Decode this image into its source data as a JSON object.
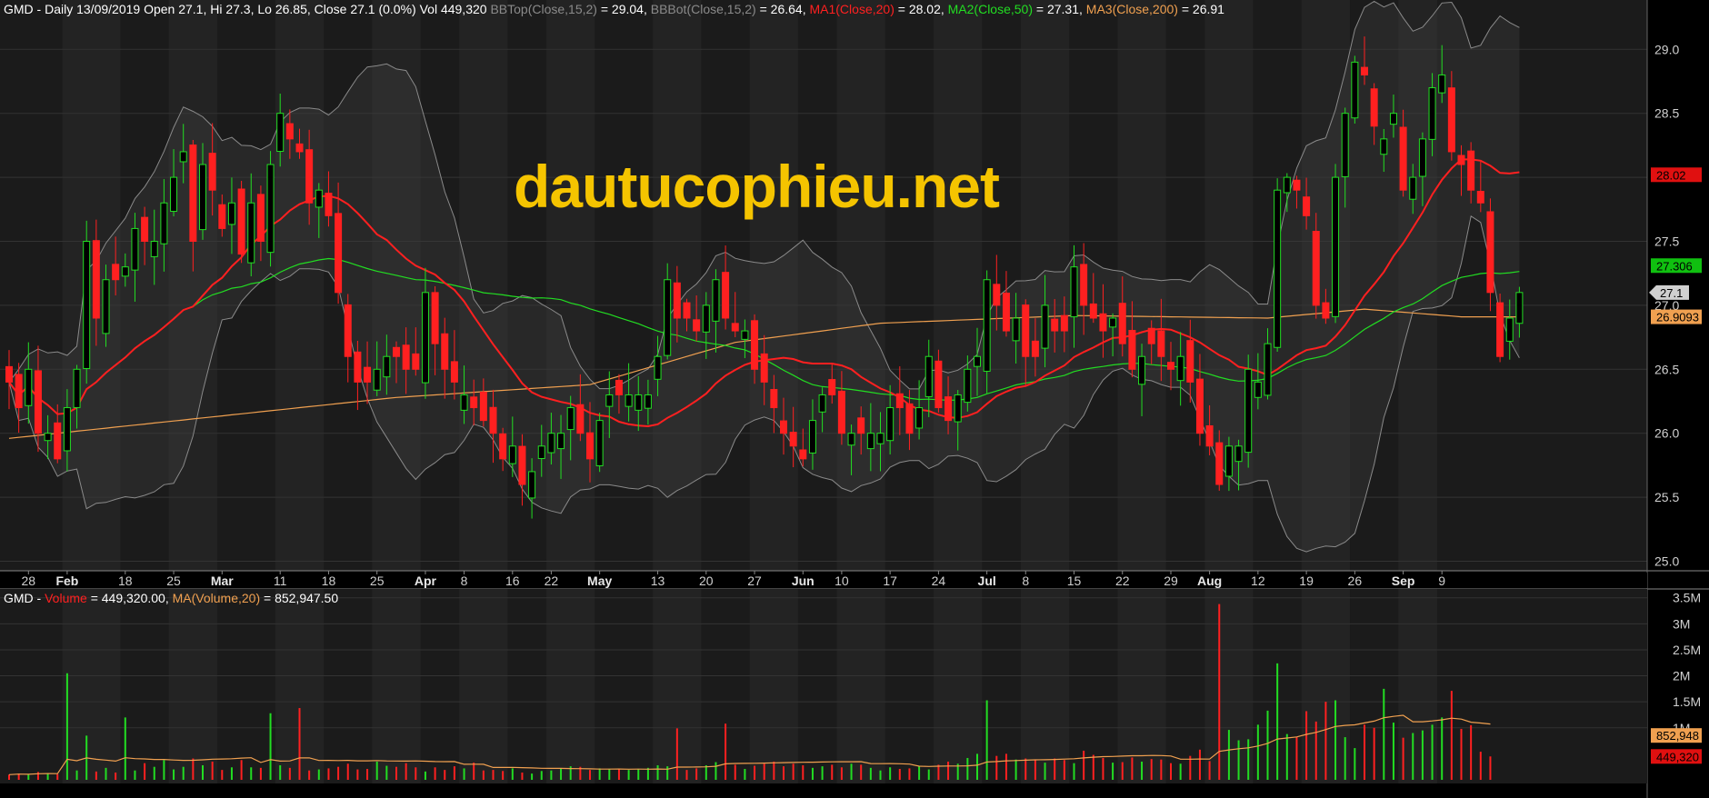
{
  "header": {
    "price_parts": [
      {
        "text": "GMD - Daily 13/09/2019 Open 27.1, Hi 27.3, Lo 26.85, Close 27.1 (0.0%) Vol 449,320 ",
        "color": "#ffffff"
      },
      {
        "text": "BBTop(Close,15,2)",
        "color": "#8a8a8a"
      },
      {
        "text": " = 29.04, ",
        "color": "#ffffff"
      },
      {
        "text": "BBBot(Close,15,2)",
        "color": "#8a8a8a"
      },
      {
        "text": " = 26.64, ",
        "color": "#ffffff"
      },
      {
        "text": "MA1(Close,20)",
        "color": "#ff2020"
      },
      {
        "text": " = 28.02, ",
        "color": "#ffffff"
      },
      {
        "text": "MA2(Close,50)",
        "color": "#22dd22"
      },
      {
        "text": " = 27.31, ",
        "color": "#ffffff"
      },
      {
        "text": "MA3(Close,200)",
        "color": "#f0a050"
      },
      {
        "text": " = 26.91",
        "color": "#ffffff"
      }
    ],
    "volume_parts": [
      {
        "text": "GMD - ",
        "color": "#ffffff"
      },
      {
        "text": "Volume",
        "color": "#ff2020"
      },
      {
        "text": " = 449,320.00, ",
        "color": "#ffffff"
      },
      {
        "text": "MA(Volume,20)",
        "color": "#f0a050"
      },
      {
        "text": " = 852,947.50",
        "color": "#ffffff"
      }
    ]
  },
  "watermark": "dautucophieu.net",
  "chart_data": [
    {
      "type": "candlestick",
      "name": "price",
      "ylim": [
        24.9,
        29.3
      ],
      "y_ticks": [
        {
          "value": 25.0,
          "label": "25.0"
        },
        {
          "value": 25.5,
          "label": "25.5"
        },
        {
          "value": 26.0,
          "label": "26.0"
        },
        {
          "value": 26.5,
          "label": "26.5"
        },
        {
          "value": 27.0,
          "label": "27.0"
        },
        {
          "value": 27.5,
          "label": "27.5"
        },
        {
          "value": 28.0,
          "label": "28.0"
        },
        {
          "value": 28.5,
          "label": "28.5"
        },
        {
          "value": 29.0,
          "label": "29.0"
        }
      ],
      "x_ticks": [
        {
          "index": 2,
          "label": "28",
          "month": false
        },
        {
          "index": 6,
          "label": "Feb",
          "month": true
        },
        {
          "index": 12,
          "label": "18",
          "month": false
        },
        {
          "index": 17,
          "label": "25",
          "month": false
        },
        {
          "index": 22,
          "label": "Mar",
          "month": true
        },
        {
          "index": 28,
          "label": "11",
          "month": false
        },
        {
          "index": 33,
          "label": "18",
          "month": false
        },
        {
          "index": 38,
          "label": "25",
          "month": false
        },
        {
          "index": 43,
          "label": "Apr",
          "month": true
        },
        {
          "index": 47,
          "label": "8",
          "month": false
        },
        {
          "index": 52,
          "label": "16",
          "month": false
        },
        {
          "index": 56,
          "label": "22",
          "month": false
        },
        {
          "index": 61,
          "label": "May",
          "month": true
        },
        {
          "index": 67,
          "label": "13",
          "month": false
        },
        {
          "index": 72,
          "label": "20",
          "month": false
        },
        {
          "index": 77,
          "label": "27",
          "month": false
        },
        {
          "index": 82,
          "label": "Jun",
          "month": true
        },
        {
          "index": 86,
          "label": "10",
          "month": false
        },
        {
          "index": 91,
          "label": "17",
          "month": false
        },
        {
          "index": 96,
          "label": "24",
          "month": false
        },
        {
          "index": 101,
          "label": "Jul",
          "month": true
        },
        {
          "index": 105,
          "label": "8",
          "month": false
        },
        {
          "index": 110,
          "label": "15",
          "month": false
        },
        {
          "index": 115,
          "label": "22",
          "month": false
        },
        {
          "index": 120,
          "label": "29",
          "month": false
        },
        {
          "index": 124,
          "label": "Aug",
          "month": true
        },
        {
          "index": 129,
          "label": "12",
          "month": false
        },
        {
          "index": 134,
          "label": "19",
          "month": false
        },
        {
          "index": 139,
          "label": "26",
          "month": false
        },
        {
          "index": 144,
          "label": "Sep",
          "month": true
        },
        {
          "index": 148,
          "label": "9",
          "month": false
        }
      ],
      "close": [
        26.4,
        26.2,
        26.5,
        26.0,
        26.0,
        25.8,
        26.2,
        26.5,
        27.5,
        26.9,
        27.2,
        27.2,
        27.3,
        27.6,
        27.5,
        27.5,
        27.8,
        28.0,
        28.2,
        27.5,
        28.1,
        27.9,
        27.6,
        27.8,
        27.4,
        27.8,
        27.5,
        28.1,
        28.5,
        28.3,
        28.2,
        27.8,
        27.9,
        27.7,
        27.1,
        26.6,
        26.4,
        26.4,
        26.5,
        26.6,
        26.6,
        26.5,
        26.5,
        27.1,
        26.7,
        26.5,
        26.4,
        26.3,
        26.2,
        26.1,
        26.0,
        25.8,
        25.9,
        25.6,
        25.7,
        25.9,
        26.0,
        26.0,
        26.2,
        26.0,
        25.8,
        26.1,
        26.3,
        26.3,
        26.3,
        26.3,
        26.3,
        26.6,
        27.2,
        26.9,
        26.9,
        26.8,
        27.0,
        27.2,
        26.9,
        26.8,
        26.8,
        26.5,
        26.4,
        26.2,
        26.0,
        25.9,
        25.8,
        26.1,
        26.3,
        26.3,
        26.0,
        26.0,
        26.0,
        26.0,
        26.0,
        26.2,
        26.2,
        26.0,
        26.2,
        26.6,
        26.2,
        26.1,
        26.3,
        26.5,
        26.6,
        27.2,
        27.0,
        26.8,
        26.9,
        26.6,
        26.6,
        27.0,
        26.8,
        26.8,
        27.3,
        27.0,
        26.9,
        26.8,
        26.9,
        26.7,
        26.5,
        26.6,
        26.7,
        26.6,
        26.5,
        26.6,
        26.4,
        26.0,
        25.9,
        25.6,
        25.9,
        25.9,
        26.5,
        26.4,
        26.7,
        27.9,
        28.0,
        27.9,
        27.7,
        27.0,
        26.9,
        28.0,
        28.5,
        28.9,
        28.8,
        28.4,
        28.3,
        28.5,
        27.9,
        28.0,
        28.3,
        28.7,
        28.8,
        28.2,
        28.1,
        27.9,
        27.8,
        27.1,
        26.6,
        26.9,
        27.1
      ],
      "volume": [
        100000,
        120000,
        100000,
        150000,
        130000,
        110000,
        2050000,
        180000,
        850000,
        160000,
        230000,
        140000,
        1200000,
        180000,
        320000,
        250000,
        380000,
        200000,
        250000,
        410000,
        280000,
        350000,
        190000,
        240000,
        380000,
        240000,
        230000,
        1280000,
        280000,
        230000,
        1380000,
        180000,
        200000,
        220000,
        250000,
        310000,
        200000,
        210000,
        350000,
        270000,
        250000,
        320000,
        240000,
        160000,
        240000,
        190000,
        260000,
        220000,
        330000,
        180000,
        190000,
        170000,
        220000,
        140000,
        120000,
        170000,
        180000,
        210000,
        260000,
        250000,
        190000,
        220000,
        210000,
        200000,
        190000,
        210000,
        230000,
        280000,
        260000,
        990000,
        190000,
        220000,
        280000,
        340000,
        1080000,
        290000,
        210000,
        270000,
        310000,
        350000,
        260000,
        310000,
        280000,
        230000,
        260000,
        290000,
        240000,
        310000,
        290000,
        230000,
        180000,
        240000,
        210000,
        220000,
        260000,
        200000,
        290000,
        350000,
        310000,
        420000,
        500000,
        1530000,
        460000,
        500000,
        390000,
        410000,
        390000,
        330000,
        410000,
        380000,
        320000,
        560000,
        480000,
        420000,
        330000,
        340000,
        430000,
        350000,
        400000,
        390000,
        320000,
        310000,
        460000,
        580000,
        360000,
        3380000,
        960000,
        760000,
        780000,
        1060000,
        1330000,
        2240000,
        880000,
        820000,
        1320000,
        1120000,
        1500000,
        1530000,
        820000,
        610000,
        1060000,
        1000000,
        1750000,
        1100000,
        810000,
        900000,
        950000,
        1060000,
        1200000,
        1710000,
        980000,
        1050000,
        540000,
        450000
      ],
      "series": [
        {
          "name": "MA1(Close,20)",
          "color": "#ff2020"
        },
        {
          "name": "MA2(Close,50)",
          "color": "#22dd22"
        },
        {
          "name": "MA3(Close,200)",
          "color": "#f0a050",
          "values_known": [
            [
              0,
              25.96
            ],
            [
              40,
              26.28
            ],
            [
              60,
              26.38
            ],
            [
              75,
              26.71
            ],
            [
              90,
              26.86
            ],
            [
              110,
              26.92
            ],
            [
              130,
              26.9
            ],
            [
              140,
              26.97
            ],
            [
              150,
              26.91
            ]
          ]
        },
        {
          "name": "BBTop(Close,15,2)",
          "color": "#888888"
        },
        {
          "name": "BBBot(Close,15,2)",
          "color": "#888888"
        }
      ],
      "price_markers": [
        {
          "label": "28.02",
          "value": 28.02,
          "bg": "#e01010",
          "fg": "#000000"
        },
        {
          "label": "27.306",
          "value": 27.31,
          "bg": "#10c010",
          "fg": "#000000"
        },
        {
          "label": "27.1",
          "value": 27.1,
          "bg": "#d0d0d0",
          "fg": "#000000",
          "arrow": true
        },
        {
          "label": "26.9093",
          "value": 26.91,
          "bg": "#f0a050",
          "fg": "#000000"
        }
      ]
    },
    {
      "type": "bar",
      "name": "volume",
      "ylim": [
        0,
        3600000
      ],
      "y_ticks": [
        {
          "value": 1000000,
          "label": "1M"
        },
        {
          "value": 1500000,
          "label": "1.5M"
        },
        {
          "value": 2000000,
          "label": "2M"
        },
        {
          "value": 2500000,
          "label": "2.5M"
        },
        {
          "value": 3000000,
          "label": "3M"
        },
        {
          "value": 3500000,
          "label": "3.5M"
        }
      ],
      "volume_markers": [
        {
          "label": "852,948",
          "value": 852948,
          "bg": "#f0a050",
          "fg": "#000000"
        },
        {
          "label": "449,320",
          "value": 449320,
          "bg": "#e01010",
          "fg": "#000000"
        }
      ]
    }
  ]
}
